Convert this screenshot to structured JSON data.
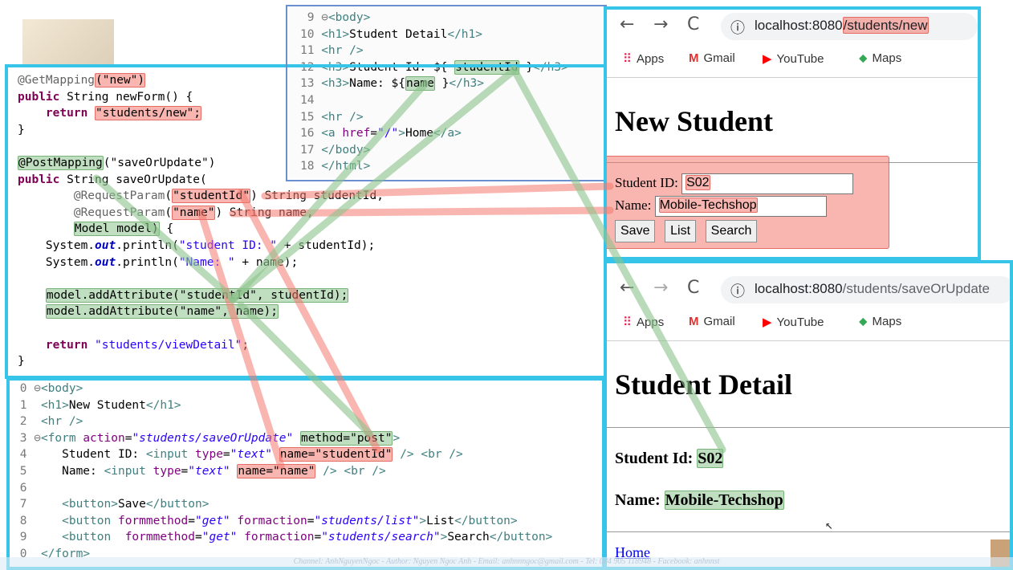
{
  "java_panel": {
    "lines": [
      {
        "parts": [
          [
            "ann",
            "@GetMapping"
          ],
          [
            "red",
            "(\"new\")"
          ]
        ]
      },
      {
        "parts": [
          [
            "kw",
            "public"
          ],
          [
            "t",
            " String newForm() {"
          ]
        ]
      },
      {
        "parts": [
          [
            "t",
            "    "
          ],
          [
            "kw",
            "return"
          ],
          [
            "t",
            " "
          ],
          [
            "red",
            "\"students/new\";"
          ]
        ]
      },
      {
        "parts": [
          [
            "t",
            "}"
          ]
        ]
      },
      {
        "parts": [
          [
            "t",
            ""
          ]
        ]
      },
      {
        "parts": [
          [
            "green",
            "@PostMapping"
          ],
          [
            "t",
            "(\"saveOrUpdate\")"
          ]
        ]
      },
      {
        "parts": [
          [
            "kw",
            "public"
          ],
          [
            "t",
            " String saveOrUpdate("
          ]
        ]
      },
      {
        "parts": [
          [
            "t",
            "        "
          ],
          [
            "ann",
            "@RequestParam"
          ],
          [
            "t",
            "("
          ],
          [
            "red",
            "\"studentId\""
          ],
          [
            "t",
            ") String studentId,"
          ]
        ]
      },
      {
        "parts": [
          [
            "t",
            "        "
          ],
          [
            "ann",
            "@RequestParam"
          ],
          [
            "t",
            "("
          ],
          [
            "red",
            "\"name\""
          ],
          [
            "t",
            ") String name,"
          ]
        ]
      },
      {
        "parts": [
          [
            "t",
            "        "
          ],
          [
            "green",
            "Model model)"
          ],
          [
            "t",
            " {"
          ]
        ]
      },
      {
        "parts": [
          [
            "t",
            "    System."
          ],
          [
            "fld",
            "out"
          ],
          [
            "t",
            ".println("
          ],
          [
            "str",
            "\"student ID: \""
          ],
          [
            "t",
            " + studentId);"
          ]
        ]
      },
      {
        "parts": [
          [
            "t",
            "    System."
          ],
          [
            "fld",
            "out"
          ],
          [
            "t",
            ".println("
          ],
          [
            "str",
            "\"Name: \""
          ],
          [
            "t",
            " + name);"
          ]
        ]
      },
      {
        "parts": [
          [
            "t",
            ""
          ]
        ]
      },
      {
        "parts": [
          [
            "t",
            "    "
          ],
          [
            "green",
            "model.addAttribute(\"studentId\", studentId);"
          ]
        ]
      },
      {
        "parts": [
          [
            "t",
            "    "
          ],
          [
            "green",
            "model.addAttribute(\"name\", name);"
          ]
        ]
      },
      {
        "parts": [
          [
            "t",
            ""
          ]
        ]
      },
      {
        "parts": [
          [
            "t",
            "    "
          ],
          [
            "kw",
            "return"
          ],
          [
            "t",
            " "
          ],
          [
            "str",
            "\"students/viewDetail\""
          ],
          [
            "t",
            ";"
          ]
        ]
      },
      {
        "parts": [
          [
            "t",
            "}"
          ]
        ]
      }
    ]
  },
  "jsp_detail_panel": {
    "lines": [
      {
        "no": "9",
        "parts": [
          [
            "lno",
            "⊖"
          ],
          [
            "tag",
            "<body>"
          ]
        ]
      },
      {
        "no": "10",
        "parts": [
          [
            "tag",
            "<h1>"
          ],
          [
            "t",
            "Student Detail"
          ],
          [
            "tag",
            "</h1>"
          ]
        ]
      },
      {
        "no": "11",
        "parts": [
          [
            "tag",
            "<hr />"
          ]
        ]
      },
      {
        "no": "12",
        "parts": [
          [
            "tag",
            "<h3>"
          ],
          [
            "t",
            "Student Id: ${ "
          ],
          [
            "green",
            "studentId"
          ],
          [
            "t",
            " }"
          ],
          [
            "tag",
            "</h3>"
          ]
        ]
      },
      {
        "no": "13",
        "parts": [
          [
            "tag",
            "<h3>"
          ],
          [
            "t",
            "Name: ${"
          ],
          [
            "green",
            "name"
          ],
          [
            "t",
            " }"
          ],
          [
            "tag",
            "</h3>"
          ]
        ]
      },
      {
        "no": "14",
        "parts": [
          [
            "t",
            ""
          ]
        ]
      },
      {
        "no": "15",
        "parts": [
          [
            "tag",
            "<hr />"
          ]
        ]
      },
      {
        "no": "16",
        "parts": [
          [
            "tag",
            "<a "
          ],
          [
            "attr",
            "href"
          ],
          [
            "t",
            "="
          ],
          [
            "str",
            "\"/\""
          ],
          [
            "tag",
            ">"
          ],
          [
            "t",
            "Home"
          ],
          [
            "tag",
            "</a>"
          ]
        ]
      },
      {
        "no": "17",
        "parts": [
          [
            "tag",
            "</body>"
          ]
        ]
      },
      {
        "no": "18",
        "parts": [
          [
            "tag",
            "</html>"
          ]
        ]
      }
    ]
  },
  "jsp_form_panel": {
    "lines": [
      {
        "no": "0",
        "parts": [
          [
            "lno",
            "⊖"
          ],
          [
            "tag",
            "<body>"
          ]
        ]
      },
      {
        "no": "1",
        "parts": [
          [
            "t",
            " "
          ],
          [
            "tag",
            "<h1>"
          ],
          [
            "t",
            "New Student"
          ],
          [
            "tag",
            "</h1>"
          ]
        ]
      },
      {
        "no": "2",
        "parts": [
          [
            "t",
            " "
          ],
          [
            "tag",
            "<hr />"
          ]
        ]
      },
      {
        "no": "3",
        "parts": [
          [
            "lno",
            "⊖"
          ],
          [
            "tag",
            "<form "
          ],
          [
            "attr",
            "action"
          ],
          [
            "t",
            "="
          ],
          [
            "aval",
            "\"students/saveOrUpdate\""
          ],
          [
            "t",
            " "
          ],
          [
            "green",
            "method=\"post\""
          ],
          [
            "tag",
            ">"
          ]
        ]
      },
      {
        "no": "4",
        "parts": [
          [
            "t",
            "    Student ID: "
          ],
          [
            "tag",
            "<input "
          ],
          [
            "attr",
            "type"
          ],
          [
            "t",
            "="
          ],
          [
            "aval",
            "\"text\""
          ],
          [
            "t",
            " "
          ],
          [
            "red",
            "name=\"studentId\""
          ],
          [
            "t",
            " "
          ],
          [
            "tag",
            "/> <br />"
          ]
        ]
      },
      {
        "no": "5",
        "parts": [
          [
            "t",
            "    Name: "
          ],
          [
            "tag",
            "<input "
          ],
          [
            "attr",
            "type"
          ],
          [
            "t",
            "="
          ],
          [
            "aval",
            "\"text\""
          ],
          [
            "t",
            " "
          ],
          [
            "red",
            "name=\"name\""
          ],
          [
            "t",
            " "
          ],
          [
            "tag",
            "/> <br />"
          ]
        ]
      },
      {
        "no": "6",
        "parts": [
          [
            "t",
            ""
          ]
        ]
      },
      {
        "no": "7",
        "parts": [
          [
            "t",
            "    "
          ],
          [
            "tag",
            "<button>"
          ],
          [
            "t",
            "Save"
          ],
          [
            "tag",
            "</button>"
          ]
        ]
      },
      {
        "no": "8",
        "parts": [
          [
            "t",
            "    "
          ],
          [
            "tag",
            "<button "
          ],
          [
            "attr",
            "formmethod"
          ],
          [
            "t",
            "="
          ],
          [
            "aval",
            "\"get\""
          ],
          [
            "t",
            " "
          ],
          [
            "attr",
            "formaction"
          ],
          [
            "t",
            "="
          ],
          [
            "aval",
            "\"students/list\""
          ],
          [
            "tag",
            ">"
          ],
          [
            "t",
            "List"
          ],
          [
            "tag",
            "</button>"
          ]
        ]
      },
      {
        "no": "9",
        "parts": [
          [
            "t",
            "    "
          ],
          [
            "tag",
            "<button  "
          ],
          [
            "attr",
            "formmethod"
          ],
          [
            "t",
            "="
          ],
          [
            "aval",
            "\"get\""
          ],
          [
            "t",
            " "
          ],
          [
            "attr",
            "formaction"
          ],
          [
            "t",
            "="
          ],
          [
            "aval",
            "\"students/search\""
          ],
          [
            "tag",
            ">"
          ],
          [
            "t",
            "Search"
          ],
          [
            "tag",
            "</button>"
          ]
        ]
      },
      {
        "no": "0",
        "parts": [
          [
            "t",
            " "
          ],
          [
            "tag",
            "</form>"
          ]
        ]
      }
    ]
  },
  "browser_new": {
    "url_host": "localhost:8080",
    "url_path": "/students/new",
    "bookmarks": [
      "Apps",
      "Gmail",
      "YouTube",
      "Maps"
    ],
    "heading": "New Student",
    "student_id_label": "Student ID:",
    "student_id_value": "S02",
    "name_label": "Name:",
    "name_value": "Mobile-Techshop",
    "buttons": [
      "Save",
      "List",
      "Search"
    ]
  },
  "browser_detail": {
    "url_host": "localhost:8080",
    "url_path": "/students/saveOrUpdate",
    "bookmarks": [
      "Apps",
      "Gmail",
      "YouTube",
      "Maps"
    ],
    "heading": "Student Detail",
    "id_label": "Student Id:",
    "id_value": "S02",
    "name_label": "Name:",
    "name_value": "Mobile-Techshop",
    "home_link": "Home"
  },
  "footer_watermark": "Channel: AnhNguyenNgoc - Author: Nguyen Ngoc Anh - Email: anhnnngoc@gmail.com - Tel: 084 905 118948 - Facebook: anhnnst",
  "colors": {
    "frame": "#36c5e8",
    "highlight_red": "#f47870",
    "highlight_green": "#8cc38c"
  }
}
